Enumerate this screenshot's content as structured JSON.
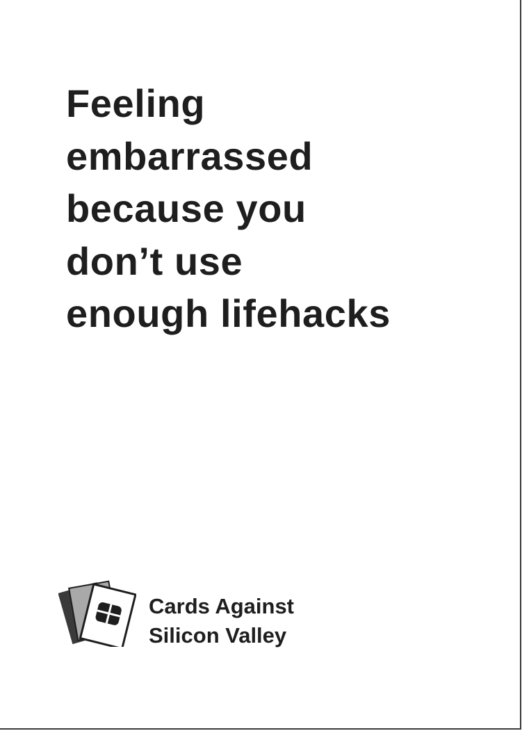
{
  "card": {
    "lines": [
      "Feeling",
      "embarrassed",
      "because you",
      "don’t use",
      "enough lifehacks"
    ]
  },
  "brand": {
    "line1": "Cards Against",
    "line2": "Silicon Valley",
    "logo_icon": "stacked-cards-icon"
  },
  "colors": {
    "text": "#1e1e1e",
    "background": "#ffffff",
    "logo_dark": "#3a3a3a",
    "logo_mid": "#a9a9a9"
  }
}
